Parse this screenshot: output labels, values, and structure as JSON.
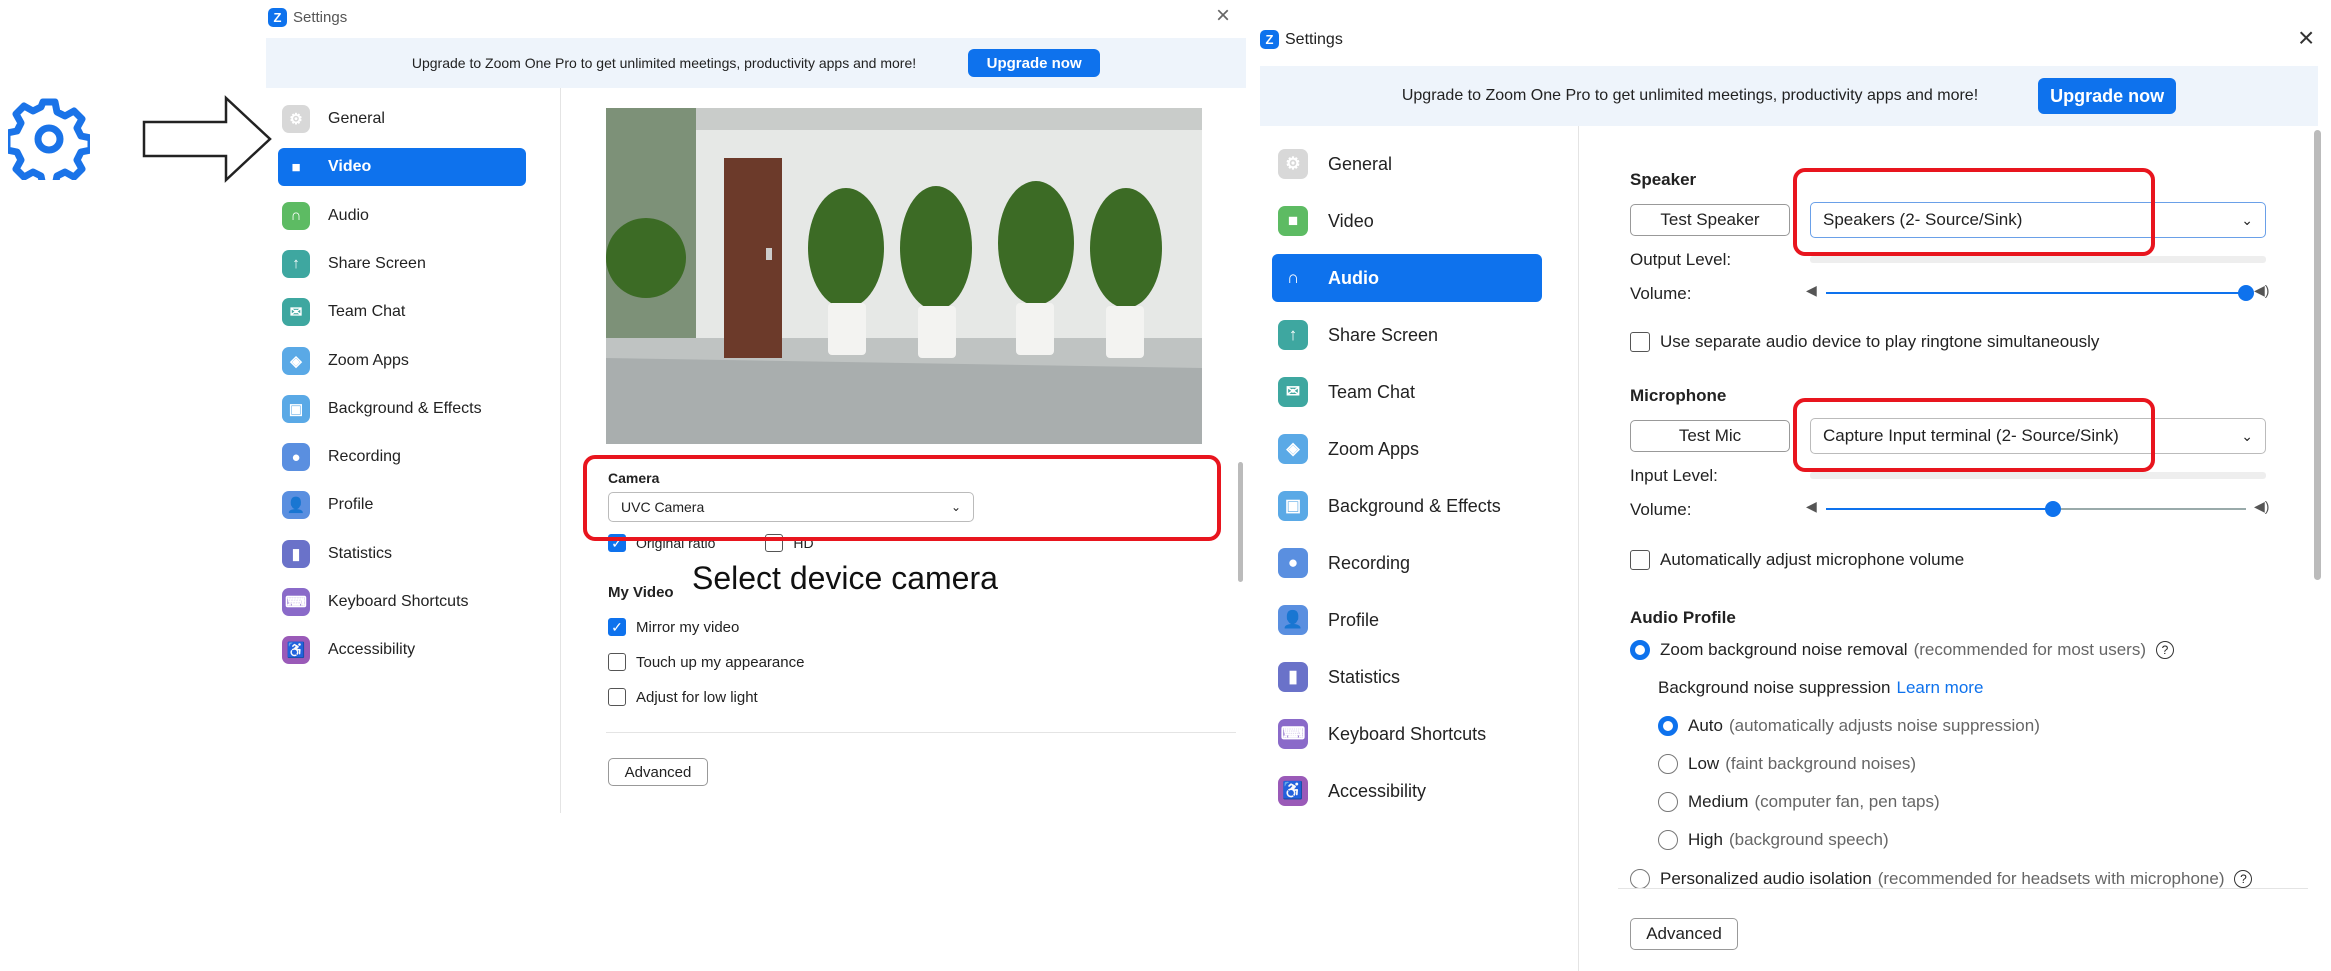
{
  "colors": {
    "accent": "#0e72ed",
    "highlight": "#e8151e"
  },
  "left_window": {
    "title": "Settings",
    "banner_text": "Upgrade to Zoom One Pro to get unlimited meetings, productivity apps and more!",
    "upgrade_button": "Upgrade now",
    "nav": [
      {
        "label": "General",
        "icon": "gear-icon"
      },
      {
        "label": "Video",
        "icon": "video-camera-icon"
      },
      {
        "label": "Audio",
        "icon": "headphones-icon"
      },
      {
        "label": "Share Screen",
        "icon": "share-screen-icon"
      },
      {
        "label": "Team Chat",
        "icon": "chat-icon"
      },
      {
        "label": "Zoom Apps",
        "icon": "apps-icon"
      },
      {
        "label": "Background & Effects",
        "icon": "background-icon"
      },
      {
        "label": "Recording",
        "icon": "record-icon"
      },
      {
        "label": "Profile",
        "icon": "profile-icon"
      },
      {
        "label": "Statistics",
        "icon": "statistics-icon"
      },
      {
        "label": "Keyboard Shortcuts",
        "icon": "keyboard-icon"
      },
      {
        "label": "Accessibility",
        "icon": "accessibility-icon"
      }
    ],
    "camera_label": "Camera",
    "camera_value": "UVC Camera",
    "original_ratio": "Original ratio",
    "hd": "HD",
    "my_video": "My Video",
    "mirror": "Mirror my video",
    "touch_up": "Touch up my appearance",
    "low_light": "Adjust for low light",
    "advanced": "Advanced",
    "annotation": "Select device camera"
  },
  "right_window": {
    "title": "Settings",
    "banner_text": "Upgrade to Zoom One Pro to get unlimited meetings, productivity apps and more!",
    "upgrade_button": "Upgrade now",
    "nav": [
      {
        "label": "General",
        "icon": "gear-icon"
      },
      {
        "label": "Video",
        "icon": "video-camera-icon"
      },
      {
        "label": "Audio",
        "icon": "headphones-icon"
      },
      {
        "label": "Share Screen",
        "icon": "share-screen-icon"
      },
      {
        "label": "Team Chat",
        "icon": "chat-icon"
      },
      {
        "label": "Zoom Apps",
        "icon": "apps-icon"
      },
      {
        "label": "Background & Effects",
        "icon": "background-icon"
      },
      {
        "label": "Recording",
        "icon": "record-icon"
      },
      {
        "label": "Profile",
        "icon": "profile-icon"
      },
      {
        "label": "Statistics",
        "icon": "statistics-icon"
      },
      {
        "label": "Keyboard Shortcuts",
        "icon": "keyboard-icon"
      },
      {
        "label": "Accessibility",
        "icon": "accessibility-icon"
      }
    ],
    "speaker_label": "Speaker",
    "test_speaker": "Test Speaker",
    "speaker_value": "Speakers (2- Source/Sink)",
    "output_level": "Output Level:",
    "volume": "Volume:",
    "speaker_volume": 1.0,
    "separate_device": "Use separate audio device to play ringtone simultaneously",
    "microphone_label": "Microphone",
    "test_mic": "Test Mic",
    "mic_value": "Capture Input terminal (2- Source/Sink)",
    "input_level": "Input Level:",
    "mic_volume": 0.54,
    "auto_adjust": "Automatically adjust microphone volume",
    "audio_profile": "Audio Profile",
    "zoom_noise": "Zoom background noise removal",
    "zoom_noise_hint": "(recommended for most users)",
    "bg_suppression": "Background noise suppression",
    "learn_more": "Learn more",
    "auto": "Auto",
    "auto_hint": "(automatically adjusts noise suppression)",
    "low": "Low",
    "low_hint": "(faint background noises)",
    "medium": "Medium",
    "medium_hint": "(computer fan, pen taps)",
    "high": "High",
    "high_hint": "(background speech)",
    "personalized": "Personalized audio isolation",
    "personalized_hint": "(recommended for headsets with microphone)",
    "advanced": "Advanced"
  }
}
